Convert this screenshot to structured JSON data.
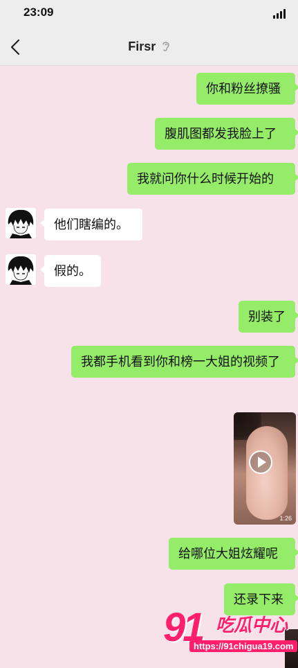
{
  "status_bar": {
    "time": "23:09"
  },
  "nav": {
    "title": "Firsr"
  },
  "messages": [
    {
      "side": "right",
      "text": "你和粉丝撩骚"
    },
    {
      "side": "right",
      "text": "腹肌图都发我脸上了"
    },
    {
      "side": "right",
      "text": "我就问你什么时候开始的"
    },
    {
      "side": "left",
      "text": "他们瞎编的。"
    },
    {
      "side": "left",
      "text": "假的。"
    },
    {
      "side": "right",
      "text": "别装了"
    },
    {
      "side": "right",
      "text": "我都手机看到你和榜一大姐的视频了"
    },
    {
      "side": "right",
      "type": "video",
      "duration": "1:26"
    },
    {
      "side": "right",
      "text": "给哪位大姐炫耀呢"
    },
    {
      "side": "right",
      "text": "还录下来"
    }
  ],
  "watermark": {
    "number": "91",
    "text": "吃瓜中心",
    "url": "https://91chigua19.com"
  },
  "colors": {
    "bubble_self": "#95ec69",
    "bubble_other": "#ffffff",
    "background": "#f7e2e9",
    "watermark": "#ff1f6b"
  }
}
